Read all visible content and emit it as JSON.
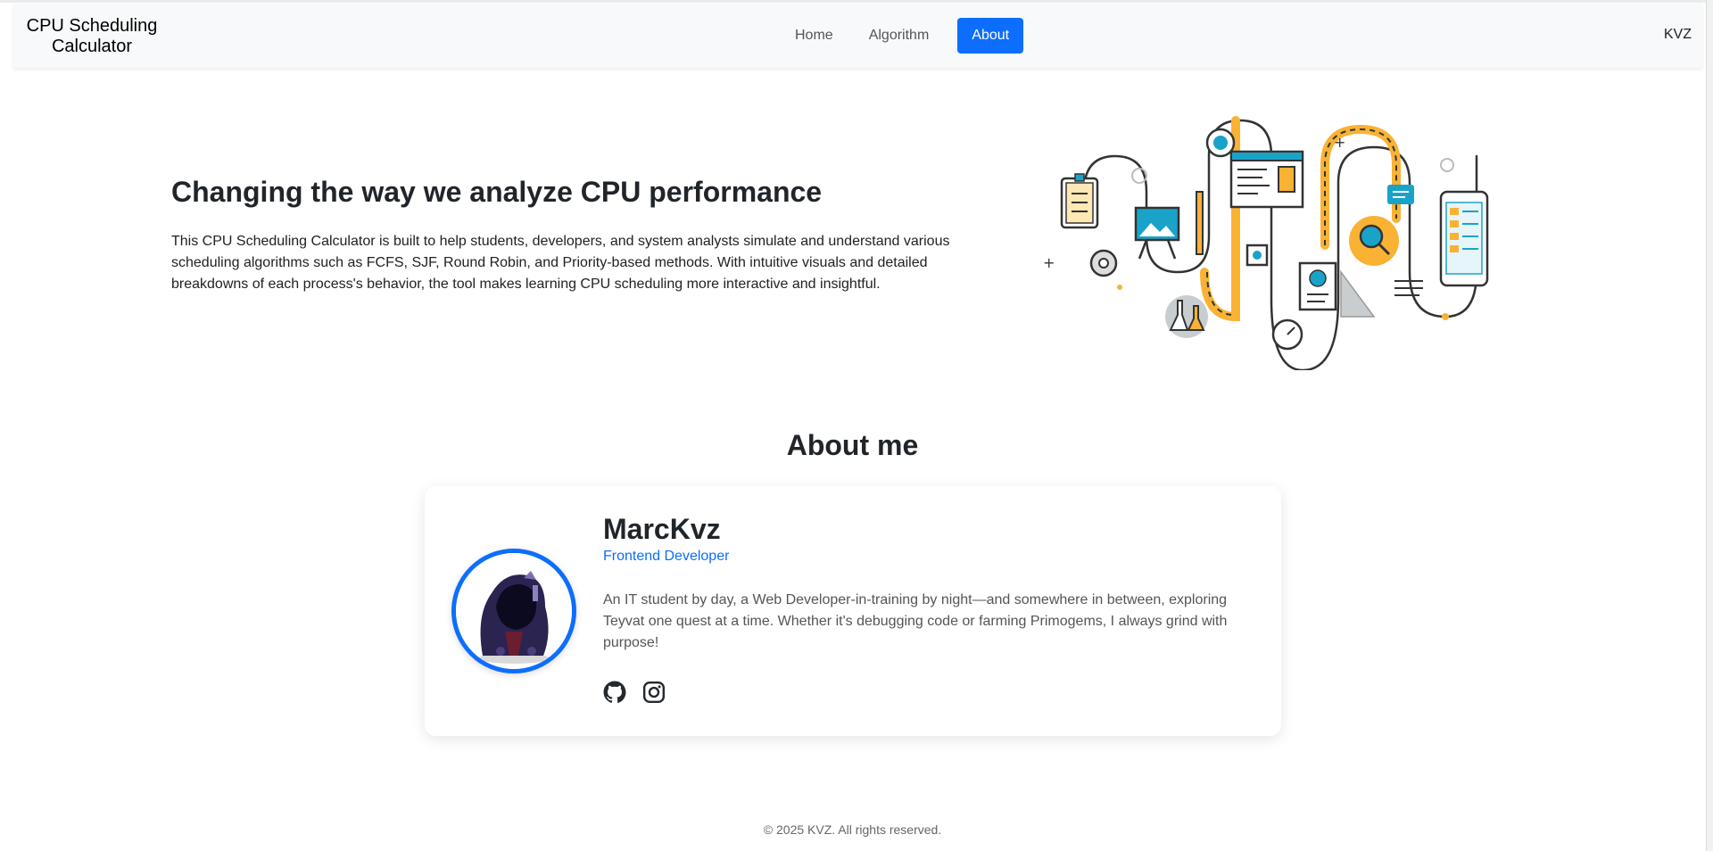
{
  "navbar": {
    "brand": "CPU Scheduling Calculator",
    "links": [
      {
        "label": "Home"
      },
      {
        "label": "Algorithm"
      },
      {
        "label": "About"
      }
    ],
    "user": "KVZ"
  },
  "hero": {
    "title": "Changing the way we analyze CPU performance",
    "text": "This CPU Scheduling Calculator is built to help students, developers, and system analysts simulate and understand various scheduling algorithms such as FCFS, SJF, Round Robin, and Priority-based methods. With intuitive visuals and detailed breakdowns of each process's behavior, the tool makes learning CPU scheduling more interactive and insightful."
  },
  "about": {
    "title": "About me",
    "name": "MarcKvz",
    "role": "Frontend Developer",
    "bio": "An IT student by day, a Web Developer-in-training by night—and somewhere in between, exploring Teyvat one quest at a time. Whether it's debugging code or farming Primogems, I always grind with purpose!",
    "socials": [
      "github-icon",
      "instagram-icon"
    ]
  },
  "footer": {
    "text": "© 2025 KVZ. All rights reserved."
  },
  "colors": {
    "primary": "#0d6efd",
    "accent_yellow": "#f9b233",
    "accent_teal": "#1aa3c8"
  }
}
